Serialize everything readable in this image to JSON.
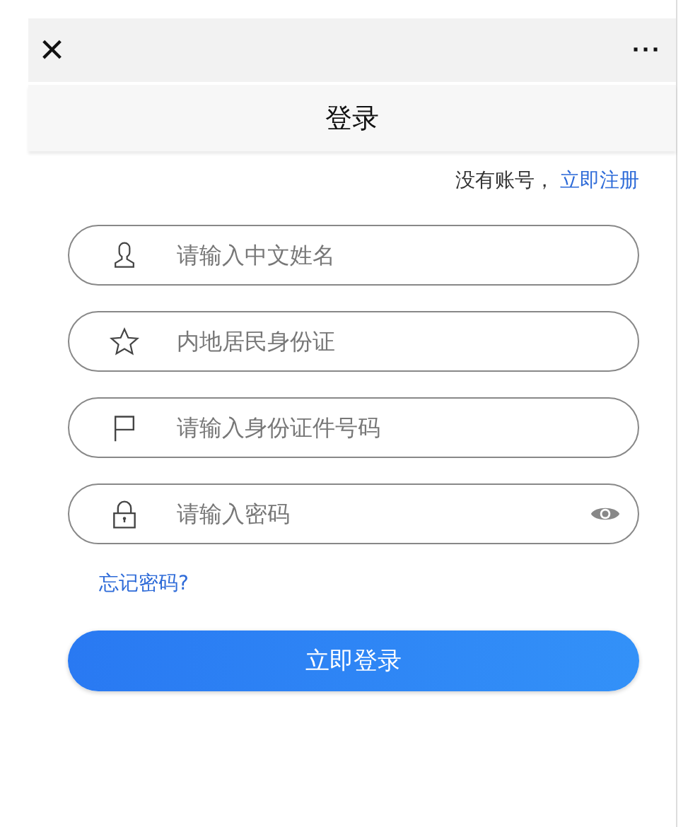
{
  "top_bar": {
    "close": "×",
    "more": "···"
  },
  "title": "登录",
  "register": {
    "prompt": "没有账号，",
    "link": "立即注册"
  },
  "fields": [
    {
      "kind": "name",
      "placeholder": "请输入中文姓名"
    },
    {
      "kind": "document",
      "placeholder": "内地居民身份证"
    },
    {
      "kind": "number",
      "placeholder": "请输入身份证件号码"
    },
    {
      "kind": "password",
      "placeholder": "请输入密码"
    }
  ],
  "forgot": "忘记密码?",
  "submit": "立即登录"
}
